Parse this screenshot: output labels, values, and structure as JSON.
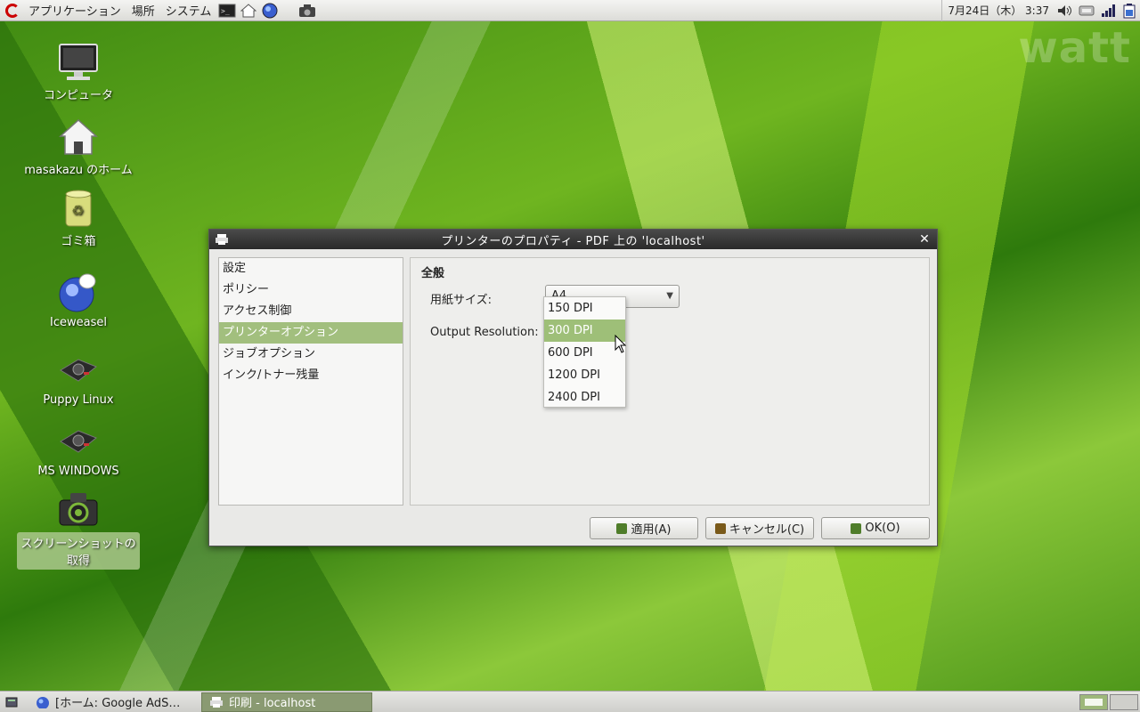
{
  "top_panel": {
    "menus": [
      "アプリケーション",
      "場所",
      "システム"
    ],
    "clock": "7月24日（木） 3:37"
  },
  "watermark": "watt",
  "desktop_icons": [
    {
      "label": "コンピュータ",
      "icon": "monitor-icon"
    },
    {
      "label": "masakazu のホーム",
      "icon": "home-icon"
    },
    {
      "label": "ゴミ箱",
      "icon": "trash-icon"
    },
    {
      "label": "Iceweasel",
      "icon": "iceweasel-icon"
    },
    {
      "label": "Puppy Linux",
      "icon": "drive-icon"
    },
    {
      "label": "MS WINDOWS",
      "icon": "drive-icon"
    },
    {
      "label": "スクリーンショットの取得",
      "icon": "camera-icon"
    }
  ],
  "dialog": {
    "title": "プリンターのプロパティ  -  PDF 上の  'localhost'",
    "sidebar": [
      "設定",
      "ポリシー",
      "アクセス制御",
      "プリンターオプション",
      "ジョブオプション",
      "インク/トナー残量"
    ],
    "active_index": 3,
    "section_title": "全般",
    "paper_size_label": "用紙サイズ:",
    "paper_size_value": "A4",
    "resolution_label": "Output Resolution:",
    "resolution_options": [
      "150 DPI",
      "300 DPI",
      "600 DPI",
      "1200 DPI",
      "2400 DPI"
    ],
    "hovered_option": 1,
    "buttons": {
      "apply": "適用(A)",
      "cancel": "キャンセル(C)",
      "ok": "OK(O)"
    }
  },
  "taskbar": {
    "tasks": [
      "[ホーム: Google AdS…",
      "印刷  -  localhost"
    ],
    "active_task": 1
  }
}
